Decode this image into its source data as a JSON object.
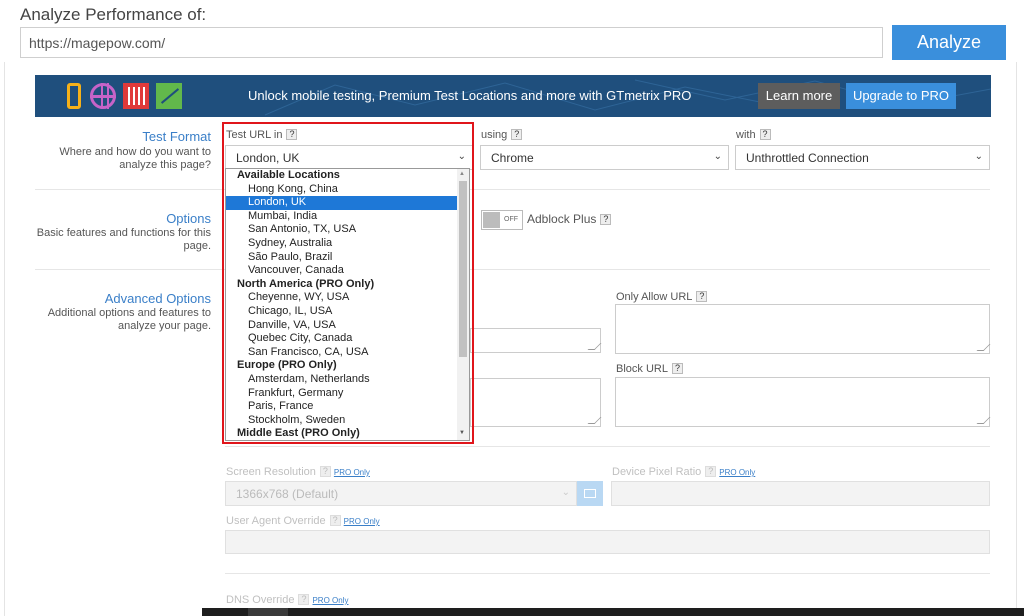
{
  "header": {
    "title": "Analyze Performance of:",
    "url_value": "https://magepow.com/",
    "analyze_label": "Analyze"
  },
  "banner": {
    "text": "Unlock mobile testing, Premium Test Locations and more with GTmetrix PRO",
    "learn_more": "Learn more",
    "upgrade": "Upgrade to PRO"
  },
  "test_format": {
    "title": "Test Format",
    "desc_1": "Where and how do you want to",
    "desc_2": "analyze this page?",
    "location_label": "Test URL in",
    "location_value": "London, UK",
    "browser_label": "using",
    "browser_value": "Chrome",
    "connection_label": "with",
    "connection_value": "Unthrottled Connection",
    "help": "?"
  },
  "options": {
    "title": "Options",
    "desc_1": "Basic features and functions for this",
    "desc_2": "page.",
    "toggle_text": "OFF",
    "adblock_label": "Adblock Plus"
  },
  "advanced": {
    "title": "Advanced Options",
    "desc_1": "Additional options and features to",
    "desc_2": "analyze your page.",
    "only_allow_label": "Only Allow URL",
    "block_label": "Block URL",
    "screen_res_label": "Screen Resolution",
    "screen_res_value": "1366x768 (Default)",
    "pixel_ratio_label": "Device Pixel Ratio",
    "user_agent_label": "User Agent Override",
    "dns_label": "DNS Override",
    "pro_only": "PRO Only"
  },
  "location_list": [
    {
      "label": "Available Locations",
      "group": true
    },
    {
      "label": "Hong Kong, China"
    },
    {
      "label": "London, UK",
      "selected": true
    },
    {
      "label": "Mumbai, India"
    },
    {
      "label": "San Antonio, TX, USA"
    },
    {
      "label": "Sydney, Australia"
    },
    {
      "label": "São Paulo, Brazil"
    },
    {
      "label": "Vancouver, Canada"
    },
    {
      "label": "North America (PRO Only)",
      "group": true
    },
    {
      "label": "Cheyenne, WY, USA"
    },
    {
      "label": "Chicago, IL, USA"
    },
    {
      "label": "Danville, VA, USA"
    },
    {
      "label": "Quebec City, Canada"
    },
    {
      "label": "San Francisco, CA, USA"
    },
    {
      "label": "Europe (PRO Only)",
      "group": true
    },
    {
      "label": "Amsterdam, Netherlands"
    },
    {
      "label": "Frankfurt, Germany"
    },
    {
      "label": "Paris, France"
    },
    {
      "label": "Stockholm, Sweden"
    },
    {
      "label": "Middle East (PRO Only)",
      "group": true
    }
  ],
  "colors": {
    "accent": "#3a8fdc",
    "banner_bg": "#1f4f7d",
    "highlight_border": "#e0151b",
    "selected_bg": "#1e78d7"
  }
}
